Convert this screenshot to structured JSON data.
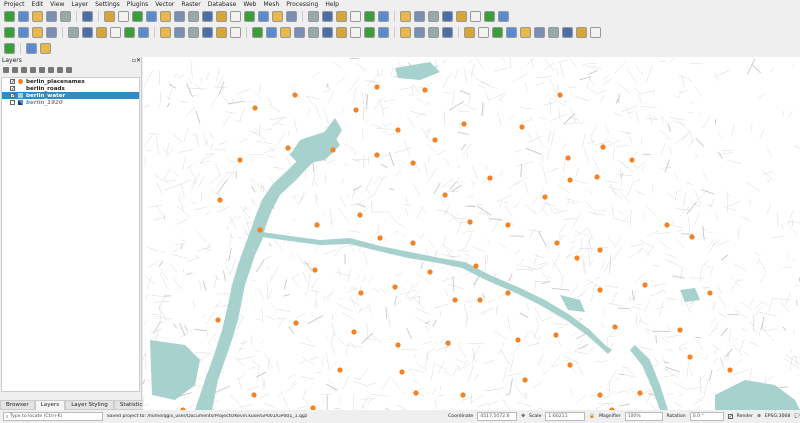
{
  "menu": [
    "Project",
    "Edit",
    "View",
    "Layer",
    "Settings",
    "Plugins",
    "Vector",
    "Raster",
    "Database",
    "Web",
    "Mesh",
    "Processing",
    "Help"
  ],
  "layers_panel": {
    "title": "Layers",
    "layers": [
      {
        "name": "berlin_placenames",
        "checked": true,
        "selected": false
      },
      {
        "name": "berlin_roads",
        "checked": true,
        "selected": false
      },
      {
        "name": "berlin_water",
        "checked": true,
        "selected": true
      },
      {
        "name": "berlin_1920",
        "checked": false,
        "selected": false
      }
    ]
  },
  "tabs": [
    "Browser",
    "Layers",
    "Layer Styling",
    "Statistics"
  ],
  "status": {
    "locate_placeholder": "Type to locate (Ctrl+K)",
    "message": "Saved project to: /home/qgis_user/Documents/Projects/Kevin.kuse/GP001/GP001_1.qgz",
    "coordinate_label": "Coordinate",
    "coordinate": "4517,5072.6",
    "scale_label": "Scale",
    "scale": "1:60211",
    "magnifier_label": "Magnifier",
    "magnifier": "100%",
    "rotation_label": "Rotation",
    "rotation": "0.0 °",
    "render_label": "Render",
    "crs": "EPSG:3068"
  },
  "colors": {
    "water": "#a6d1cd",
    "placename": "#f58220",
    "selection": "#308cc6",
    "roads": "#c8c8c8"
  }
}
